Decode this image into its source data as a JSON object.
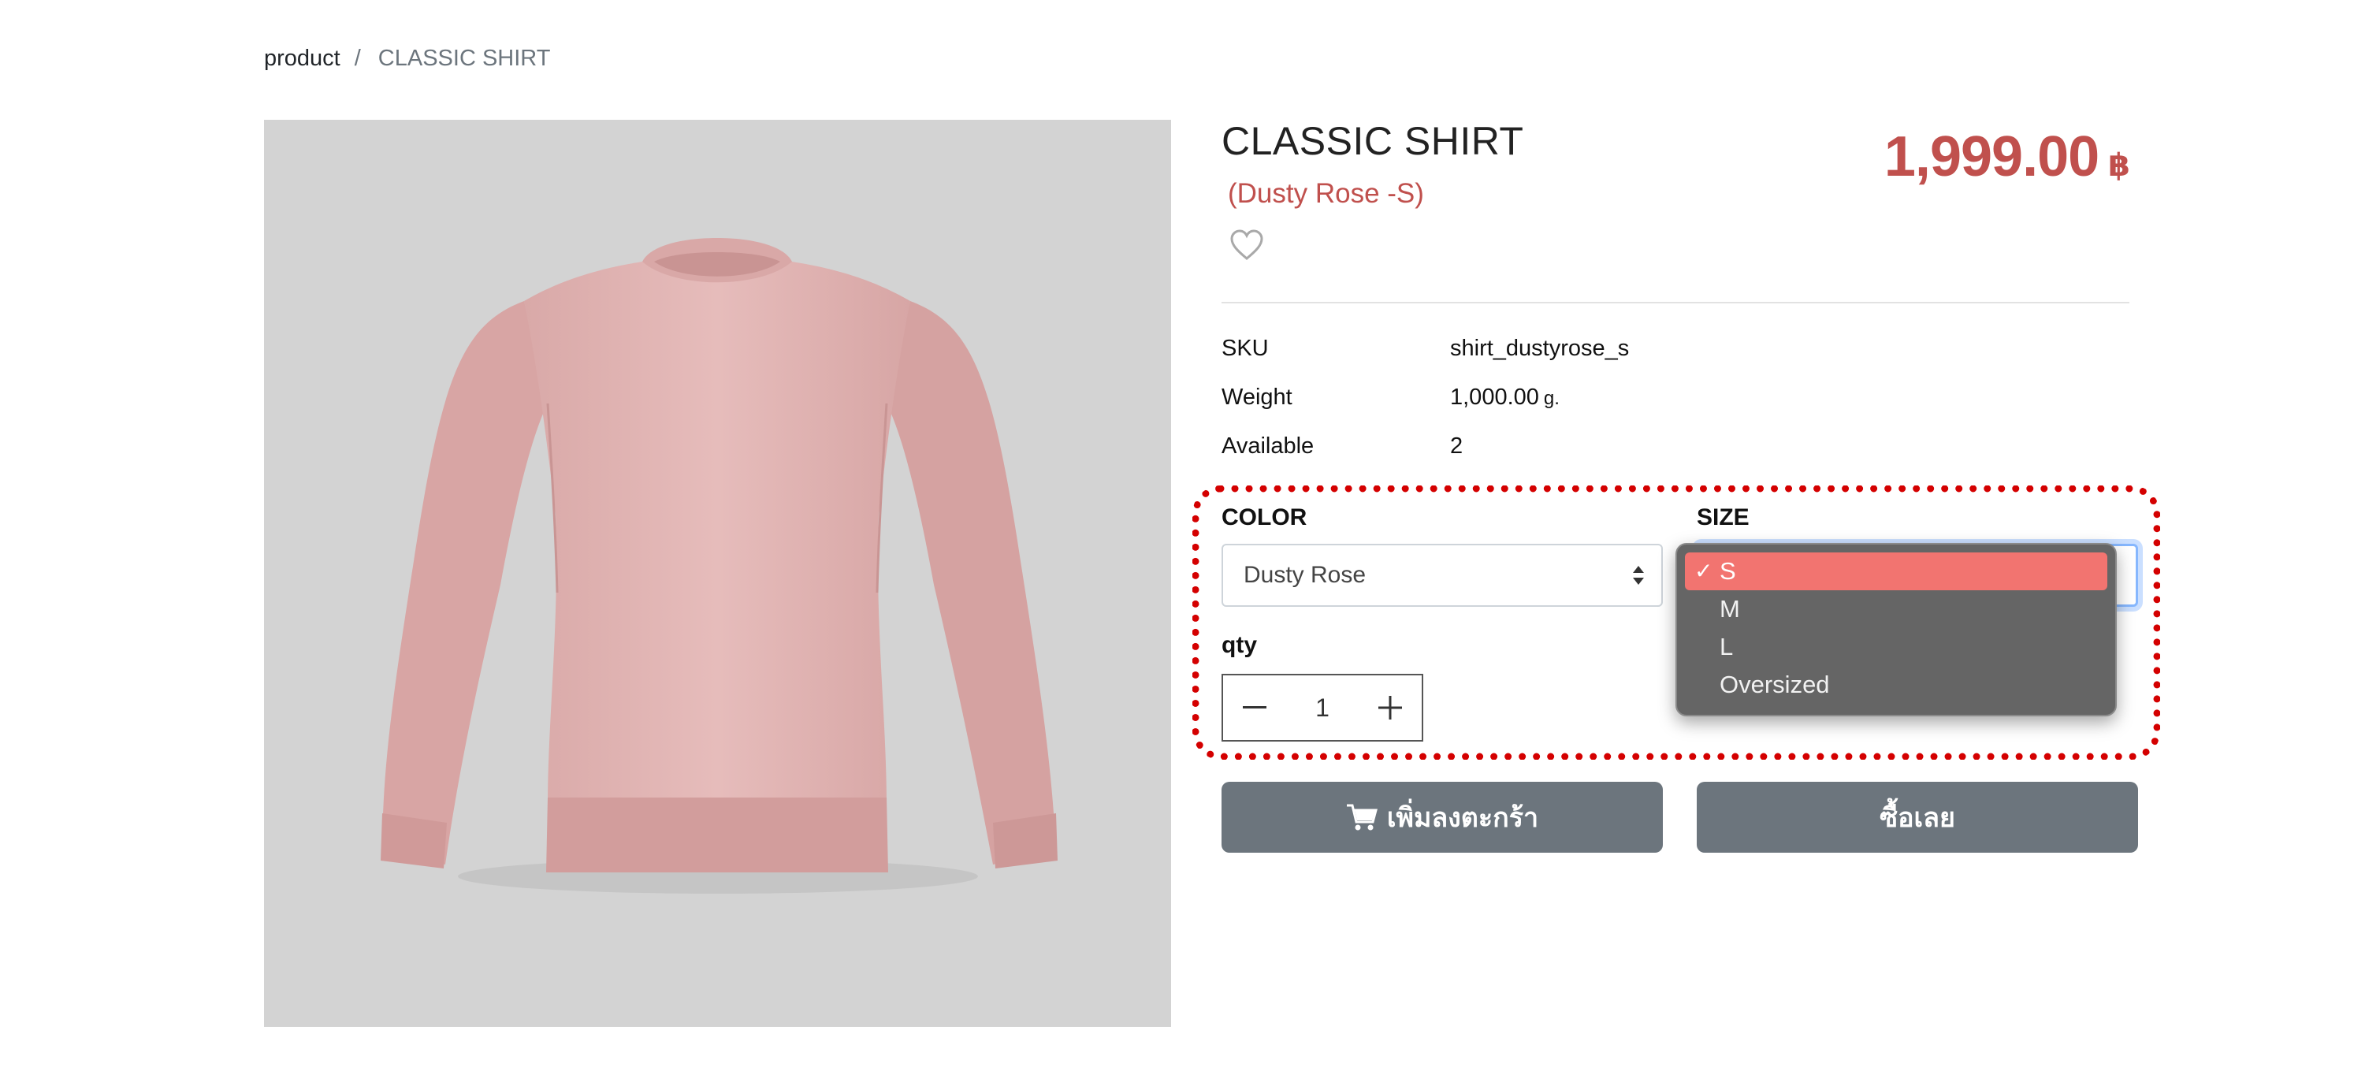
{
  "breadcrumb": {
    "home_label": "product",
    "separator": "/",
    "current_label": "CLASSIC SHIRT"
  },
  "product": {
    "title": "CLASSIC SHIRT",
    "variant": "(Dusty Rose -S)",
    "price": "1,999.00",
    "currency": "฿",
    "wishlist_icon": "heart-outline-icon",
    "image_color": "#e2b7b6"
  },
  "specs": [
    {
      "key": "SKU",
      "value": "shirt_dustyrose_s",
      "unit": ""
    },
    {
      "key": "Weight",
      "value": "1,000.00",
      "unit": "g."
    },
    {
      "key": "Available",
      "value": "2",
      "unit": ""
    }
  ],
  "options": {
    "color_label": "COLOR",
    "color_value": "Dusty Rose",
    "size_label": "SIZE",
    "size_options": [
      "S",
      "M",
      "L",
      "Oversized"
    ],
    "size_selected": "S",
    "qty_label": "qty",
    "qty_value": "1"
  },
  "actions": {
    "add_to_cart_label": "เพิ่มลงตะกร้า",
    "buy_now_label": "ซื้อเลย",
    "cart_icon": "cart-icon"
  },
  "colors": {
    "accent_red": "#c0504d",
    "button_gray": "#6c757d",
    "dropdown_bg": "#656565",
    "dropdown_selected": "#f27470",
    "highlight": "#d40000"
  }
}
